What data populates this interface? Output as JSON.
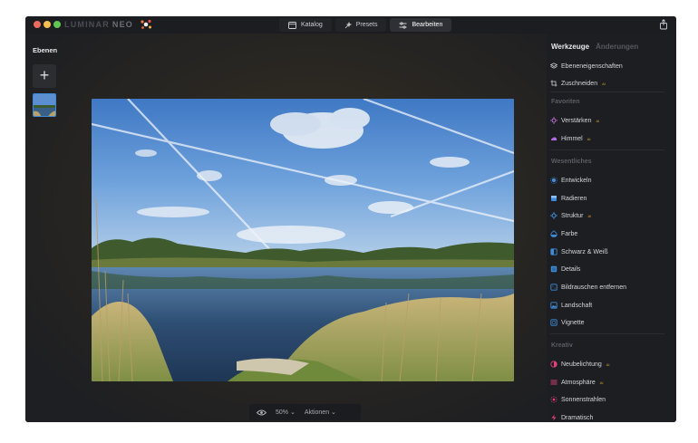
{
  "app": {
    "logo": "LUMINAR",
    "logo_suffix": "NEO"
  },
  "colors": {
    "accent": "#3e8bd9",
    "ai_badge": "#d9a52a",
    "bg": "#202226",
    "panel": "#1d1e21"
  },
  "topnav": {
    "tabs": [
      {
        "label": "Katalog",
        "icon": "catalog-icon"
      },
      {
        "label": "Presets",
        "icon": "presets-icon"
      },
      {
        "label": "Bearbeiten",
        "icon": "edit-sliders-icon",
        "active": true
      }
    ]
  },
  "layers": {
    "title": "Ebenen"
  },
  "bottombar": {
    "zoom": "50%",
    "actions": "Aktionen"
  },
  "panel": {
    "tabs": {
      "tools": "Werkzeuge",
      "changes": "Änderungen"
    },
    "top_items": [
      {
        "label": "Ebeneneigenschaften",
        "icon": "layers-icon",
        "ai": ""
      },
      {
        "label": "Zuschneiden",
        "icon": "crop-icon",
        "ai": "AI"
      }
    ],
    "sections": {
      "favorites": "Favoriten",
      "essentials": "Wesentliches",
      "creative": "Kreativ"
    },
    "favorites": [
      {
        "label": "Verstärken",
        "icon": "enhance-icon",
        "ai": "AI",
        "color": "#c873e6"
      },
      {
        "label": "Himmel",
        "icon": "sky-icon",
        "ai": "AI",
        "color": "#b46be0"
      }
    ],
    "essentials": [
      {
        "label": "Entwickeln",
        "icon": "develop-icon",
        "ai": "",
        "color": "#3e8bd9"
      },
      {
        "label": "Radieren",
        "icon": "erase-icon",
        "ai": "",
        "color": "#3e8bd9"
      },
      {
        "label": "Struktur",
        "icon": "structure-icon",
        "ai": "AI",
        "color": "#3e8bd9"
      },
      {
        "label": "Farbe",
        "icon": "color-icon",
        "ai": "",
        "color": "#3e8bd9"
      },
      {
        "label": "Schwarz & Weiß",
        "icon": "bw-icon",
        "ai": "",
        "color": "#3e8bd9"
      },
      {
        "label": "Details",
        "icon": "details-icon",
        "ai": "",
        "color": "#3e8bd9"
      },
      {
        "label": "Bildrauschen entfernen",
        "icon": "denoise-icon",
        "ai": "",
        "color": "#3e8bd9"
      },
      {
        "label": "Landschaft",
        "icon": "landscape-icon",
        "ai": "",
        "color": "#3e8bd9"
      },
      {
        "label": "Vignette",
        "icon": "vignette-icon",
        "ai": "",
        "color": "#3e8bd9"
      }
    ],
    "creative": [
      {
        "label": "Neubelichtung",
        "icon": "relight-icon",
        "ai": "AI",
        "color": "#e0417a"
      },
      {
        "label": "Atmosphäre",
        "icon": "atmosphere-icon",
        "ai": "AI",
        "color": "#e0417a"
      },
      {
        "label": "Sonnenstrahlen",
        "icon": "sunrays-icon",
        "ai": "",
        "color": "#e0417a"
      },
      {
        "label": "Dramatisch",
        "icon": "dramatic-icon",
        "ai": "",
        "color": "#e0417a"
      }
    ]
  }
}
